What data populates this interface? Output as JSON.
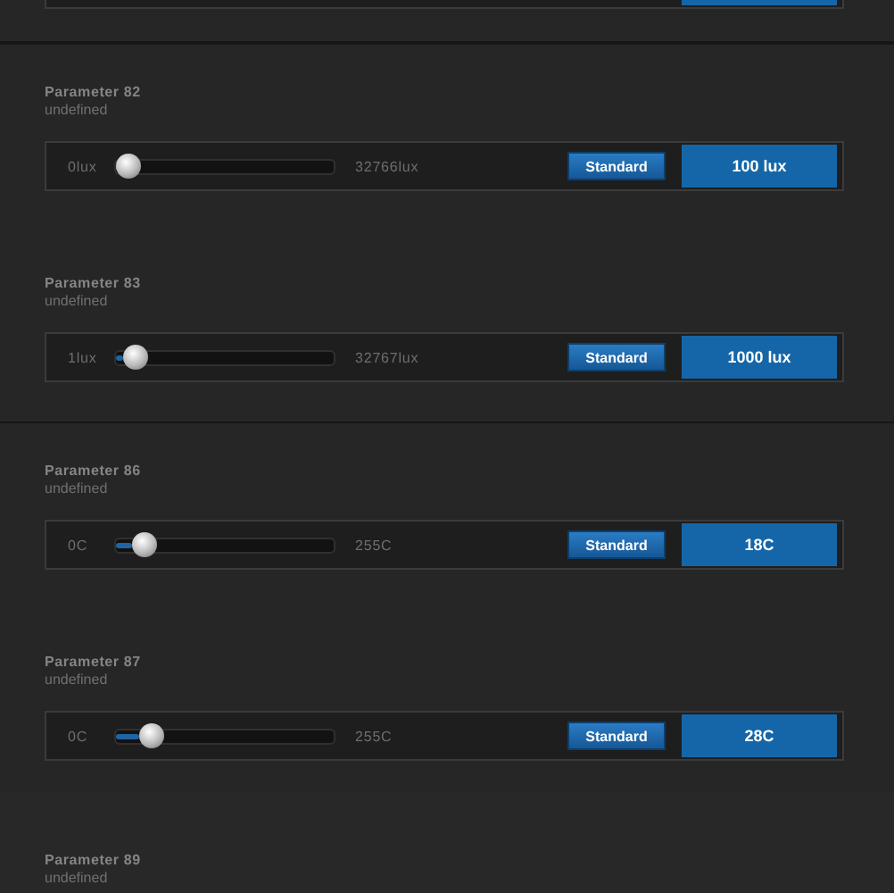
{
  "groups": [
    {
      "parameters": [
        {
          "title": "Parameter 82",
          "subtitle": "undefined",
          "min_label": "0lux",
          "max_label": "32766lux",
          "level": 0.003,
          "button": "Standard",
          "value": "100 lux"
        },
        {
          "title": "Parameter 83",
          "subtitle": "undefined",
          "min_label": "1lux",
          "max_label": "32767lux",
          "level": 0.03,
          "button": "Standard",
          "value": "1000 lux"
        }
      ]
    },
    {
      "parameters": [
        {
          "title": "Parameter 86",
          "subtitle": "undefined",
          "min_label": "0C",
          "max_label": "255C",
          "level": 0.07,
          "button": "Standard",
          "value": "18C"
        },
        {
          "title": "Parameter 87",
          "subtitle": "undefined",
          "min_label": "0C",
          "max_label": "255C",
          "level": 0.11,
          "button": "Standard",
          "value": "28C"
        }
      ]
    },
    {
      "parameters": [
        {
          "title": "Parameter 89",
          "subtitle": "undefined"
        }
      ]
    }
  ]
}
